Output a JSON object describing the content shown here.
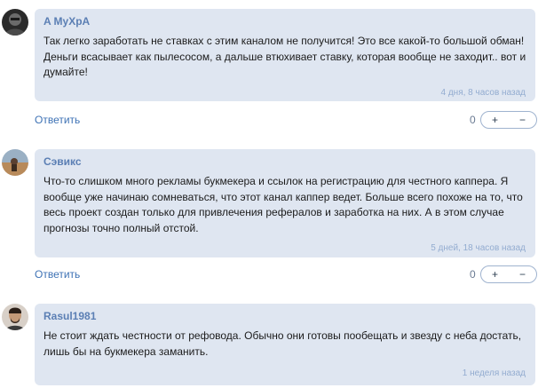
{
  "comments": [
    {
      "author": "A MyXpA",
      "text": "Так легко заработать не ставках с этим каналом не получится! Это все какой-то большой обман! Деньги всасывает как пылесосом, а дальше втюхивает ставку, которая вообще не заходит.. вот и думайте!",
      "time": "4 дня, 8 часов назад",
      "reply_label": "Ответить",
      "votes": "0",
      "plus": "+",
      "minus": "−"
    },
    {
      "author": "Сэвикс",
      "text": "Что-то слишком много рекламы букмекера и ссылок на регистрацию для честного каппера. Я вообще уже начинаю сомневаться, что этот канал каппер ведет. Больше всего похоже на то, что весь проект создан только для привлечения рефералов и заработка на них. А в этом случае прогнозы точно полный отстой.",
      "time": "5 дней, 18 часов назад",
      "reply_label": "Ответить",
      "votes": "0",
      "plus": "+",
      "minus": "−"
    },
    {
      "author": "Rasul1981",
      "text": "Не стоит ждать честности от рефовода. Обычно они готовы пообещать и звезду с неба достать, лишь бы на букмекера заманить.",
      "time": "1 неделя назад"
    }
  ]
}
